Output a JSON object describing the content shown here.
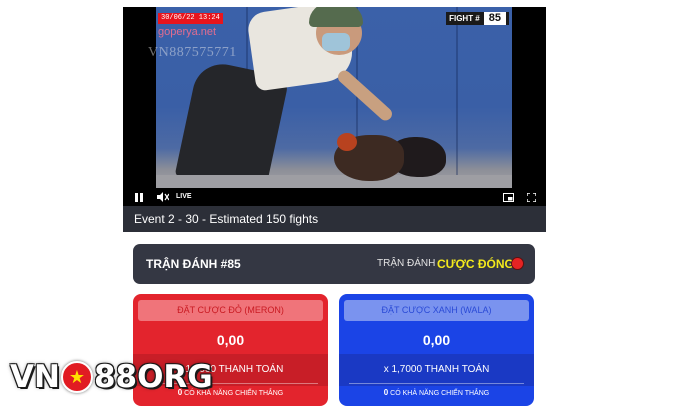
{
  "video": {
    "timestamp": "30/06/22 13:24",
    "watermark_site": "goperya.net",
    "watermark_code": "VN887575771",
    "fight_label": "FIGHT #",
    "fight_number": "85",
    "live_label": "LIVE",
    "icons": [
      "pause-icon",
      "mute-icon",
      "pip-icon",
      "fullscreen-icon"
    ]
  },
  "event": {
    "info": "Event 2 - 30 - Estimated 150 fights"
  },
  "match": {
    "title": "TRẬN ĐÁNH #85",
    "status_label": "TRẬN ĐÁNH",
    "status_value": "CƯỢC ĐÓNG",
    "status_color": "#e52323"
  },
  "bets": {
    "meron": {
      "button_label": "ĐẶT CƯỢC ĐỎ (MERON)",
      "amount": "0,00",
      "odds": "x 1,0000 THANH TOÁN",
      "chance_value": "0",
      "chance_label": "CÓ KHẢ NĂNG CHIẾN THẮNG",
      "color": "#e3242d"
    },
    "wala": {
      "button_label": "ĐẶT CƯỢC XANH (WALA)",
      "amount": "0,00",
      "odds": "x 1,7000 THANH TOÁN",
      "chance_value": "0",
      "chance_label": "CÓ KHẢ NĂNG CHIẾN THẮNG",
      "color": "#1b44e6"
    }
  },
  "brand": {
    "left": "VN",
    "right": "88ORG"
  }
}
